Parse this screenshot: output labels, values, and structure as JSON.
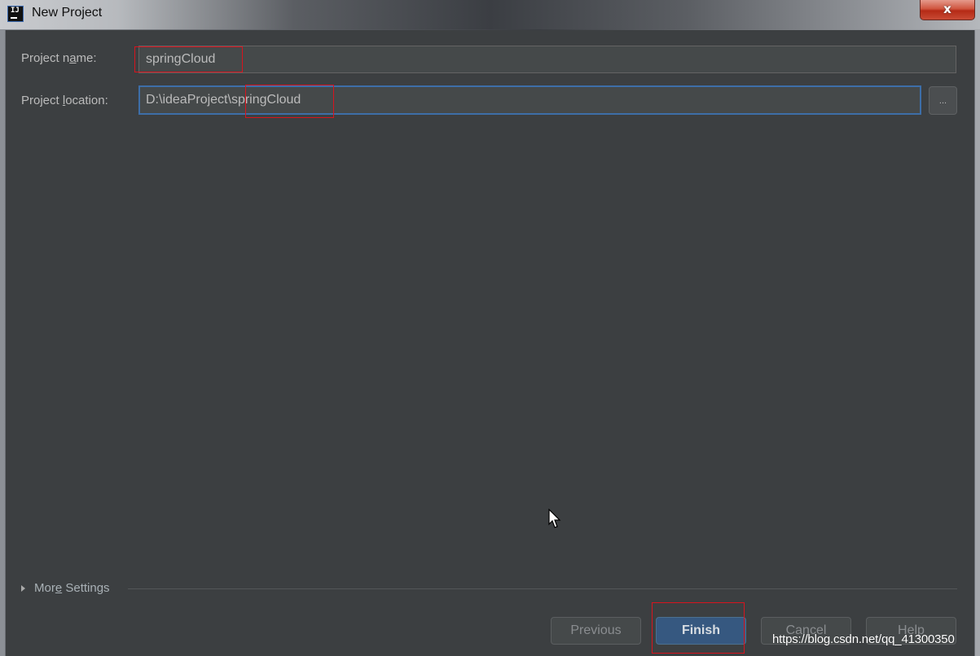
{
  "window": {
    "title": "New Project",
    "app_icon_text": "IJ",
    "close_glyph": "x"
  },
  "form": {
    "project_name": {
      "label_pre": "Project n",
      "label_mnemonic": "a",
      "label_post": "me:",
      "value": "springCloud"
    },
    "project_location": {
      "label_pre": "Project ",
      "label_mnemonic": "l",
      "label_post": "ocation:",
      "value": "D:\\ideaProject\\springCloud",
      "browse_label": "..."
    }
  },
  "more_settings": {
    "label_pre": "Mor",
    "label_mnemonic": "e",
    "label_post": " Settings",
    "expanded": false
  },
  "buttons": {
    "previous": "Previous",
    "finish": "Finish",
    "cancel": "Cancel",
    "help": "Help"
  },
  "colors": {
    "dialog_bg": "#3c3f41",
    "primary_button": "#365880",
    "focus_border": "#3d6ea8",
    "annotation_red": "#d8141e"
  },
  "watermark": "https://blog.csdn.net/qq_41300350"
}
